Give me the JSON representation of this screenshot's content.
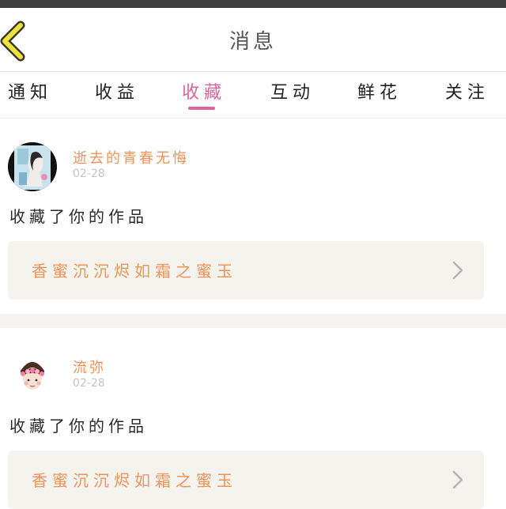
{
  "header": {
    "title": "消息",
    "back_icon": "chevron-left-icon",
    "accent": "#d9649e"
  },
  "tabs": [
    {
      "label": "通知",
      "active": false
    },
    {
      "label": "收益",
      "active": false
    },
    {
      "label": "收藏",
      "active": true
    },
    {
      "label": "互动",
      "active": false
    },
    {
      "label": "鲜花",
      "active": false
    },
    {
      "label": "关注",
      "active": false
    }
  ],
  "messages": [
    {
      "username": "逝去的青春无悔",
      "date": "02-28",
      "action": "收藏了你的作品",
      "work_title": "香蜜沉沉烬如霜之蜜玉"
    },
    {
      "username": "流弥",
      "date": "02-28",
      "action": "收藏了你的作品",
      "work_title": "香蜜沉沉烬如霜之蜜玉"
    }
  ]
}
